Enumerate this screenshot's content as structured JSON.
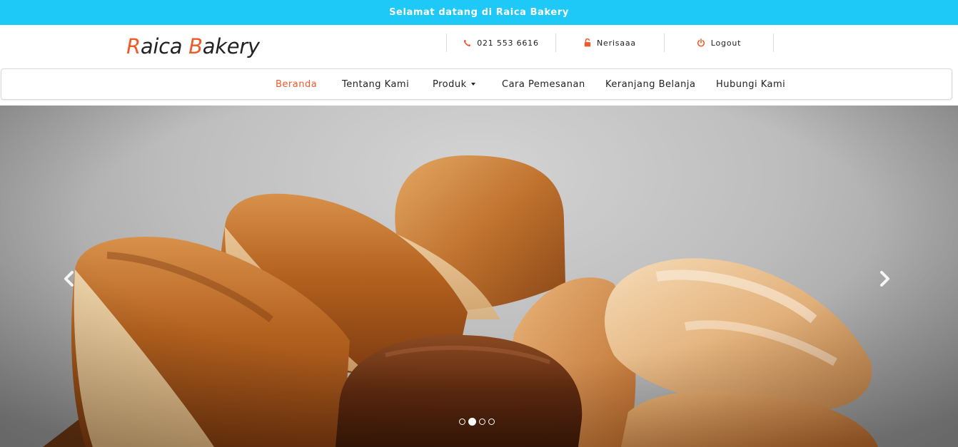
{
  "topbar": {
    "welcome": "Selamat datang di Raica Bakery"
  },
  "logo": {
    "letter1": "R",
    "part1": "aica ",
    "letter2": "B",
    "part2": "akery"
  },
  "contact": {
    "phone": "021 553 6616",
    "user": "Nerisaaa",
    "logout": "Logout"
  },
  "nav": {
    "items": [
      {
        "label": "Beranda",
        "active": true
      },
      {
        "label": "Tentang Kami",
        "active": false
      },
      {
        "label": "Produk",
        "active": false,
        "dropdown": true
      },
      {
        "label": "Cara Pemesanan",
        "active": false
      },
      {
        "label": "Keranjang Belanja",
        "active": false
      },
      {
        "label": "Hubungi Kami",
        "active": false
      }
    ]
  },
  "carousel": {
    "slide_count": 4,
    "active_index": 1,
    "image_subject": "bread-loaves-photo"
  },
  "colors": {
    "topbar_bg": "#1ec8f7",
    "accent": "#f05a28",
    "text": "#222222"
  },
  "icons": {
    "phone": "phone-icon",
    "user": "lock-open-icon",
    "logout": "power-icon",
    "prev": "chevron-left-icon",
    "next": "chevron-right-icon"
  }
}
